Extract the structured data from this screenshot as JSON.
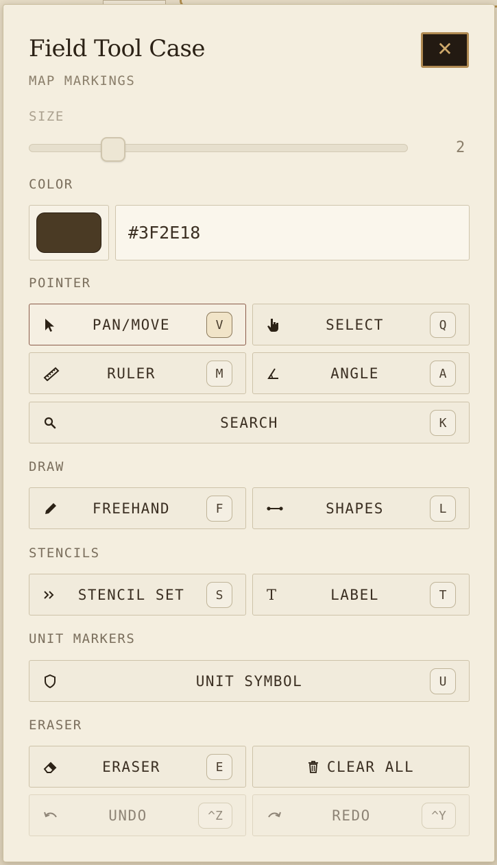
{
  "panel": {
    "title": "Field Tool Case",
    "subtitle": "MAP MARKINGS",
    "close_label": "✕"
  },
  "size": {
    "label": "SIZE",
    "value": "2"
  },
  "color": {
    "label": "COLOR",
    "hex": "#3F2E18",
    "swatch_color": "#4a3a24"
  },
  "sections": {
    "pointer": "POINTER",
    "draw": "DRAW",
    "stencils": "STENCILS",
    "unit_markers": "UNIT MARKERS",
    "eraser": "ERASER"
  },
  "tools": {
    "pan_move": {
      "label": "PAN/MOVE",
      "key": "V",
      "icon": "cursor-arrow-icon",
      "active": true
    },
    "select": {
      "label": "SELECT",
      "key": "Q",
      "icon": "hand-pointer-icon"
    },
    "ruler": {
      "label": "RULER",
      "key": "M",
      "icon": "ruler-icon"
    },
    "angle": {
      "label": "ANGLE",
      "key": "A",
      "icon": "angle-icon"
    },
    "search": {
      "label": "SEARCH",
      "key": "K",
      "icon": "search-icon"
    },
    "freehand": {
      "label": "FREEHAND",
      "key": "F",
      "icon": "pencil-icon"
    },
    "shapes": {
      "label": "SHAPES",
      "key": "L",
      "icon": "line-segment-icon"
    },
    "stencil_set": {
      "label": "STENCIL SET",
      "key": "S",
      "icon": "double-chevron-icon"
    },
    "label": {
      "label": "LABEL",
      "key": "T",
      "icon": "text-icon",
      "glyph": "T"
    },
    "unit_symbol": {
      "label": "UNIT SYMBOL",
      "key": "U",
      "icon": "shield-icon"
    },
    "eraser": {
      "label": "ERASER",
      "key": "E",
      "icon": "eraser-icon"
    },
    "clear_all": {
      "label": "CLEAR ALL",
      "icon": "trash-icon"
    },
    "undo": {
      "label": "UNDO",
      "key": "^Z",
      "icon": "undo-icon",
      "disabled": true
    },
    "redo": {
      "label": "REDO",
      "key": "^Y",
      "icon": "redo-icon",
      "disabled": true
    }
  }
}
